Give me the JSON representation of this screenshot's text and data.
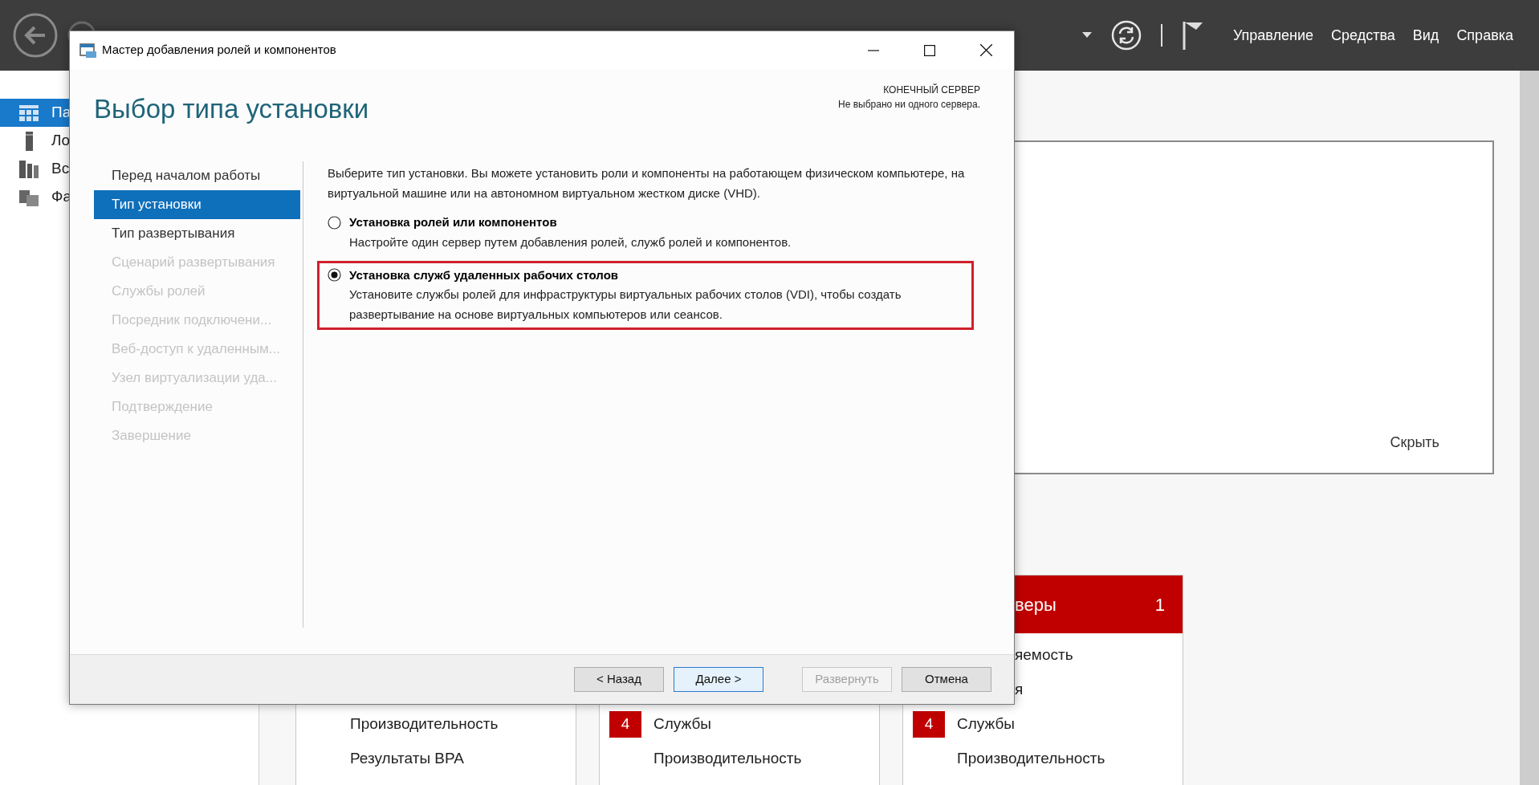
{
  "toolbar": {
    "menus": [
      "Управление",
      "Средства",
      "Вид",
      "Справка"
    ]
  },
  "sidebar": {
    "items": [
      {
        "label": "Па",
        "kind": "dashboard",
        "selected": true
      },
      {
        "label": "Ло",
        "kind": "server",
        "selected": false
      },
      {
        "label": "Вс",
        "kind": "servers",
        "selected": false
      },
      {
        "label": "Фа",
        "kind": "files",
        "selected": false
      }
    ]
  },
  "welcome_panel": {
    "hide_link": "Скрыть"
  },
  "tiles": [
    {
      "rows": [
        {
          "text": "Производительность",
          "kind": "plain"
        },
        {
          "text": "Результаты BPA",
          "kind": "plain"
        }
      ]
    },
    {
      "rows": [
        {
          "text": "Службы",
          "kind": "badge",
          "badge": "4"
        },
        {
          "text": "Производительность",
          "kind": "plain"
        }
      ]
    },
    {
      "header": {
        "title": "веры",
        "count": "1"
      },
      "rows": [
        {
          "text": "яемость",
          "kind": "clipped"
        },
        {
          "text": "я",
          "kind": "clipped"
        },
        {
          "text": "Службы",
          "kind": "badge",
          "badge": "4"
        },
        {
          "text": "Производительность",
          "kind": "plain"
        }
      ]
    }
  ],
  "dialog": {
    "title": "Мастер добавления ролей и компонентов",
    "heading": "Выбор типа установки",
    "target_label": "КОНЕЧНЫЙ СЕРВЕР",
    "target_value": "Не выбрано ни одного сервера.",
    "steps": [
      {
        "label": "Перед началом работы",
        "selected": false,
        "disabled": false
      },
      {
        "label": "Тип установки",
        "selected": true,
        "disabled": false
      },
      {
        "label": "Тип развертывания",
        "selected": false,
        "disabled": false
      },
      {
        "label": "Сценарий развертывания",
        "selected": false,
        "disabled": true
      },
      {
        "label": "Службы ролей",
        "selected": false,
        "disabled": true
      },
      {
        "label": "Посредник подключени...",
        "selected": false,
        "disabled": true
      },
      {
        "label": "Веб-доступ к удаленным...",
        "selected": false,
        "disabled": true
      },
      {
        "label": "Узел виртуализации уда...",
        "selected": false,
        "disabled": true
      },
      {
        "label": "Подтверждение",
        "selected": false,
        "disabled": true
      },
      {
        "label": "Завершение",
        "selected": false,
        "disabled": true
      }
    ],
    "intro": "Выберите тип установки. Вы можете установить роли и компоненты на работающем физическом компьютере, на виртуальной машине или на автономном виртуальном жестком диске (VHD).",
    "options": [
      {
        "label": "Установка ролей или компонентов",
        "description": "Настройте один сервер путем добавления ролей, служб ролей и компонентов.",
        "selected": false,
        "highlighted": false
      },
      {
        "label": "Установка служб удаленных рабочих столов",
        "description": "Установите службы ролей для инфраструктуры виртуальных рабочих столов (VDI), чтобы создать развертывание на основе виртуальных компьютеров или сеансов.",
        "selected": true,
        "highlighted": true
      }
    ],
    "buttons": [
      {
        "label": "< Назад",
        "disabled": false,
        "default": false
      },
      {
        "label": "Далее >",
        "disabled": false,
        "default": true
      },
      {
        "label": "Развернуть",
        "disabled": true,
        "default": false
      },
      {
        "label": "Отмена",
        "disabled": false,
        "default": false
      }
    ]
  }
}
